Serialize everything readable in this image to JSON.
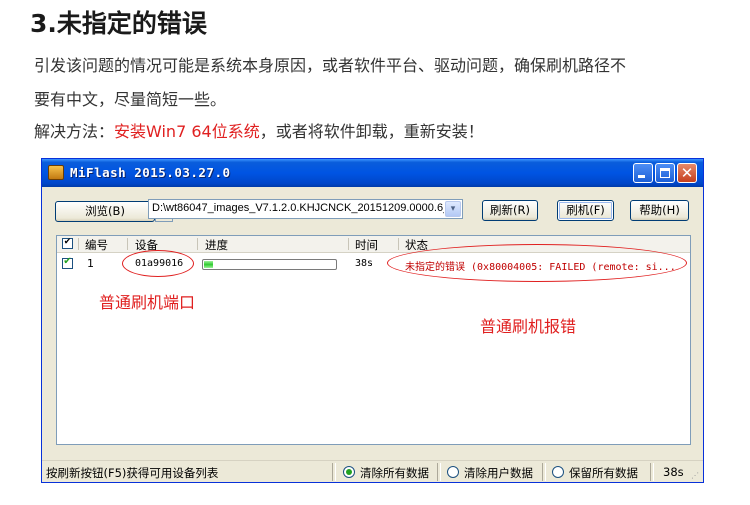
{
  "article": {
    "heading": "3.未指定的错误",
    "para1_line1": "引发该问题的情况可能是系统本身原因，或者软件平台、驱动问题，确保刷机路径不",
    "para1_line2": "要有中文，尽量简短一些。",
    "solution_prefix": "解决方法：",
    "solution_highlight": "安装Win7 64位系统",
    "solution_suffix": "，或者将软件卸载，重新安装！"
  },
  "window": {
    "title": "MiFlash 2015.03.27.0",
    "min_glyph": "_",
    "max_glyph": "□",
    "close_glyph": "✕",
    "browse_label": "浏览(B)",
    "browse_dropdown_glyph": "▼",
    "path_value": "D:\\wt86047_images_V7.1.2.0.KHJCNCK_20151209.0000.6_",
    "path_dropdown_glyph": "▾",
    "refresh_label": "刷新(R)",
    "flash_label": "刷机(F)",
    "help_label": "帮助(H)"
  },
  "grid": {
    "columns": {
      "check": "✔",
      "number": "编号",
      "device": "设备",
      "progress": "进度",
      "time": "时间",
      "status": "状态"
    },
    "rows": [
      {
        "checked": true,
        "check_glyph": "✔",
        "number": "1",
        "device": "01a99016",
        "progress_fraction": 0.08,
        "time": "38s",
        "status": "未指定的错误 (0x80004005: FAILED (remote: si..."
      }
    ]
  },
  "annotations": {
    "port_note": "普通刷机端口",
    "error_note": "普通刷机报错"
  },
  "statusbar": {
    "hint": "按刷新按钮(F5)获得可用设备列表",
    "options": [
      {
        "label": "清除所有数据",
        "selected": true
      },
      {
        "label": "清除用户数据",
        "selected": false
      },
      {
        "label": "保留所有数据",
        "selected": false
      }
    ],
    "elapsed": "38s",
    "grip_glyph": "⋰"
  },
  "colors": {
    "accent_red": "#e02020",
    "titlebar_blue": "#0054e3",
    "progress_green": "#2fcb2f"
  },
  "icons": [
    "app-icon",
    "minimize-icon",
    "maximize-icon",
    "close-icon",
    "chevron-down-icon",
    "check-icon",
    "radio-icon",
    "resize-grip-icon"
  ]
}
